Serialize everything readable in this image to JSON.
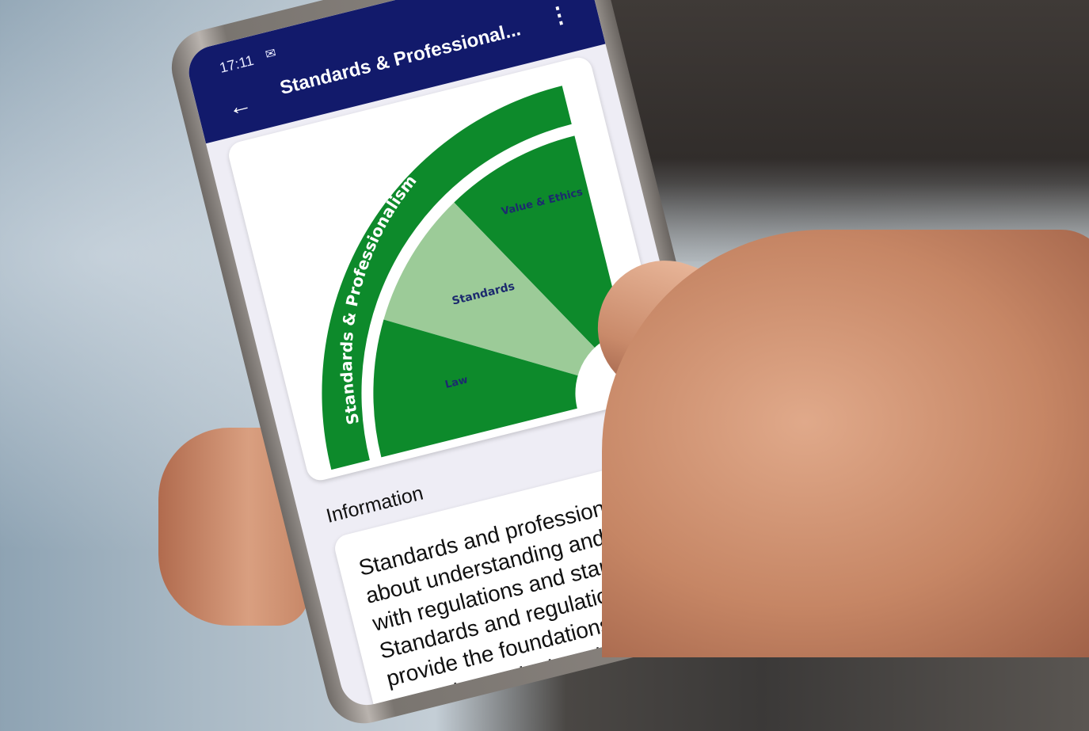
{
  "status_bar": {
    "time": "17:11"
  },
  "app_bar": {
    "title": "Standards & Professional...",
    "back_icon": "arrow-left-icon",
    "menu_icon": "more-vert-icon"
  },
  "diagram": {
    "outer_label": "Standards & Professionalism",
    "segments": [
      {
        "label": "Value & Ethics",
        "color": "#0d8a2b"
      },
      {
        "label": "Standards",
        "color": "#9ccb98"
      },
      {
        "label": "Law",
        "color": "#0d8a2b"
      }
    ],
    "arc_color": "#0d8a2b",
    "label_color": "#1c2a6e"
  },
  "information": {
    "heading": "Information",
    "body": "Standards and professionalism is about understanding and working with regulations and standards. Standards and regulations provide the foundations for the quarrying and mineral products industry."
  }
}
